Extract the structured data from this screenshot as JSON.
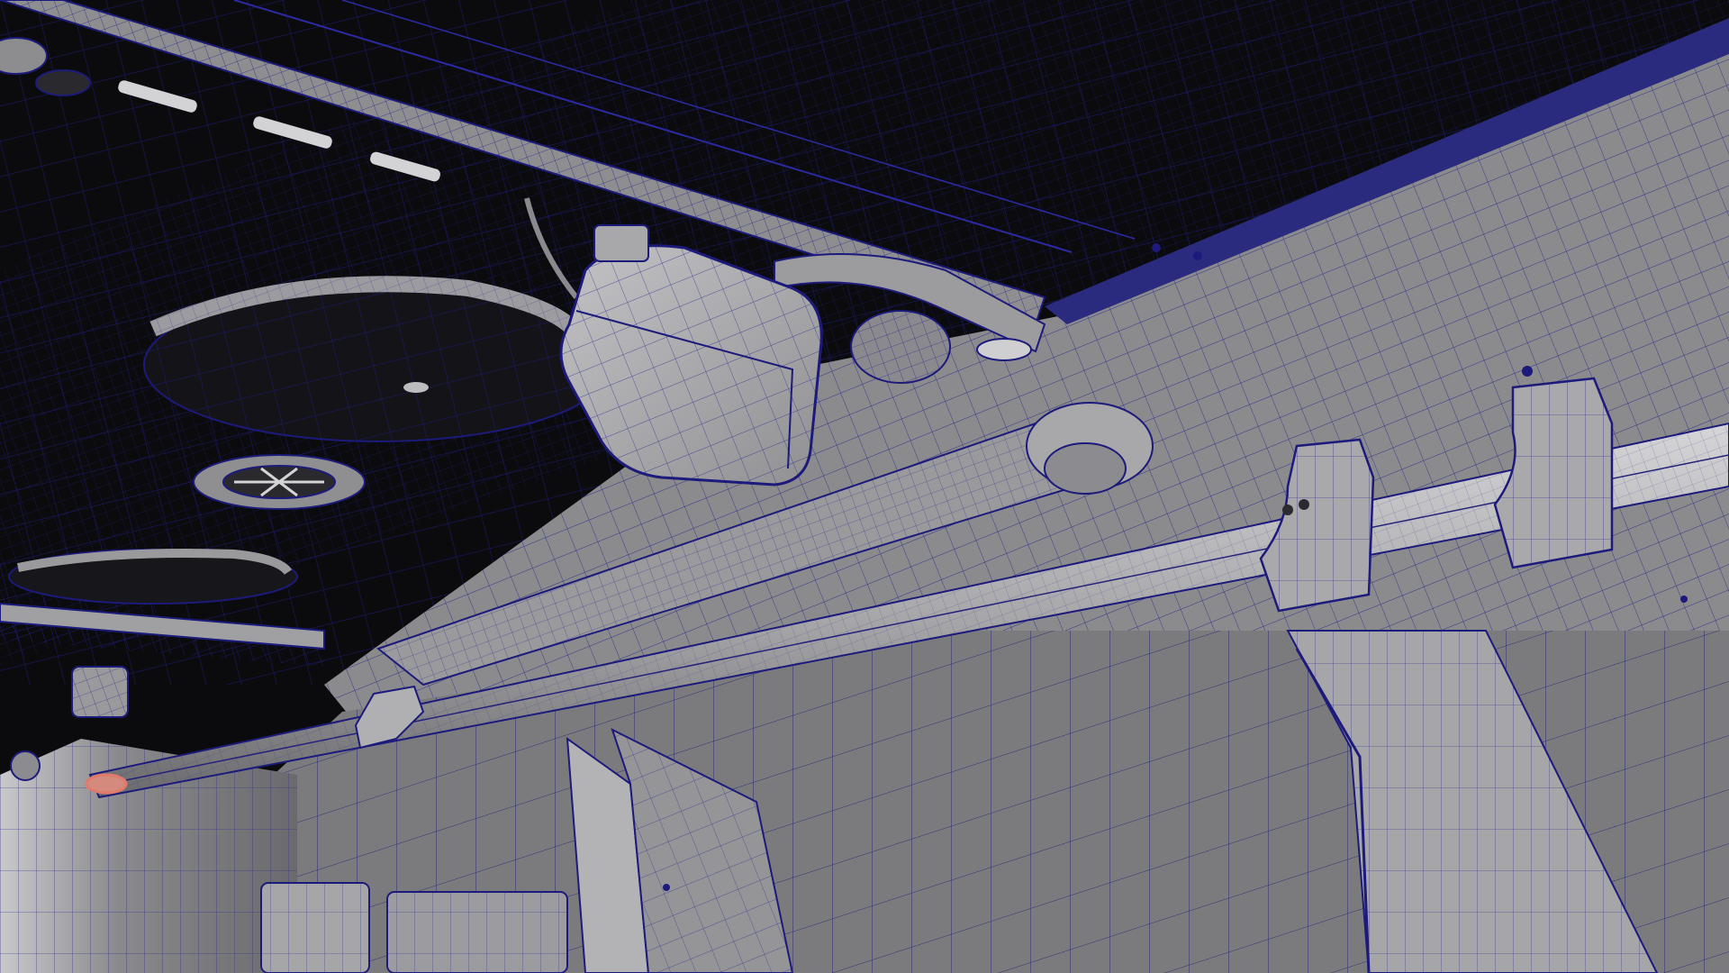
{
  "viewport": {
    "mode": "wireframe-on-shaded",
    "colors": {
      "background": "#0b0b0d",
      "wire": "#1c1a7a",
      "wire_light": "#2a2aa0",
      "surface_light": "#9a9a9c",
      "surface_mid": "#7d7d80",
      "surface_dark": "#5d5d60",
      "surface_deep": "#3f3f43",
      "highlight": "#e0e0e2",
      "selection": "#e07a6a"
    }
  }
}
